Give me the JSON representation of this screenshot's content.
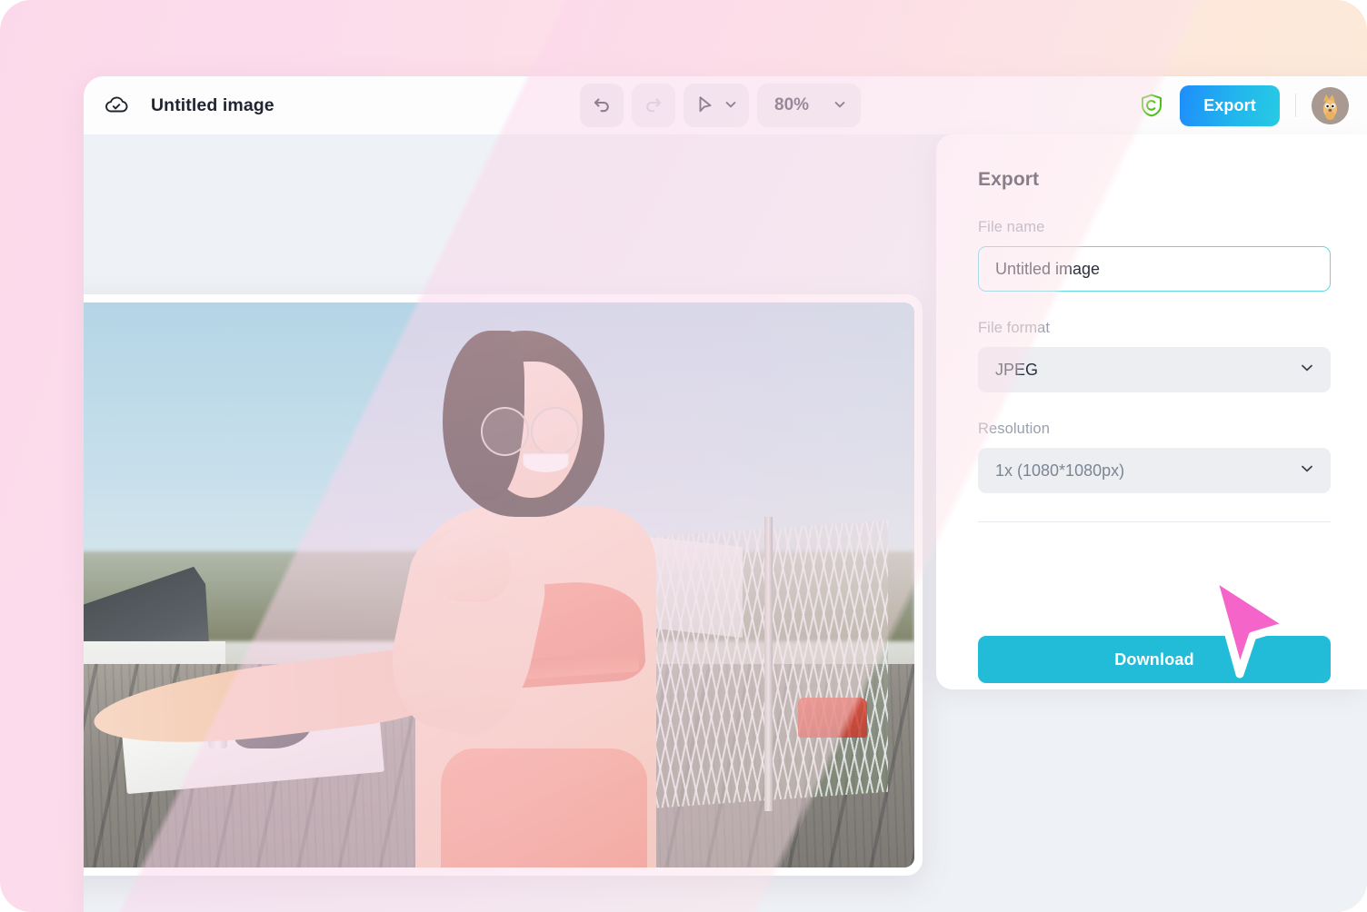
{
  "window": {
    "title_bar": {
      "cloud_icon": "cloud-check-icon",
      "document_title": "Untitled image",
      "undo_icon": "undo-arrow-icon",
      "redo_icon": "redo-arrow-icon",
      "cursor_tool_icon": "cursor-arrow-icon",
      "cursor_tool_chevron": "chevron-down-icon",
      "zoom_level": "80%",
      "zoom_chevron": "chevron-down-icon",
      "shield_icon": "shield-c-icon",
      "export_label": "Export",
      "avatar": "user-avatar"
    }
  },
  "export_panel": {
    "heading": "Export",
    "file_name": {
      "label": "File name",
      "value": "Untitled image",
      "placeholder": "Untitled image"
    },
    "file_format": {
      "label": "File format",
      "value": "JPEG",
      "chevron": "chevron-down-icon"
    },
    "resolution": {
      "label": "Resolution",
      "value": "1x (1080*1080px)",
      "chevron": "chevron-down-icon"
    },
    "download_label": "Download"
  },
  "canvas": {
    "photo_alt": "woman stretching arm on rooftop wearing coral sportswear"
  },
  "colors": {
    "accent_cyan": "#22bcd8",
    "export_gradient_start": "#1e8dfb",
    "export_gradient_end": "#27cbe3",
    "shield_green": "#4cc019",
    "cursor_pink": "#f564c8",
    "input_focus_border": "#62d7e4",
    "canvas_bg": "#eef1f5",
    "page_gradient_start": "#fcd9ea",
    "page_gradient_end": "#fdecd6"
  }
}
